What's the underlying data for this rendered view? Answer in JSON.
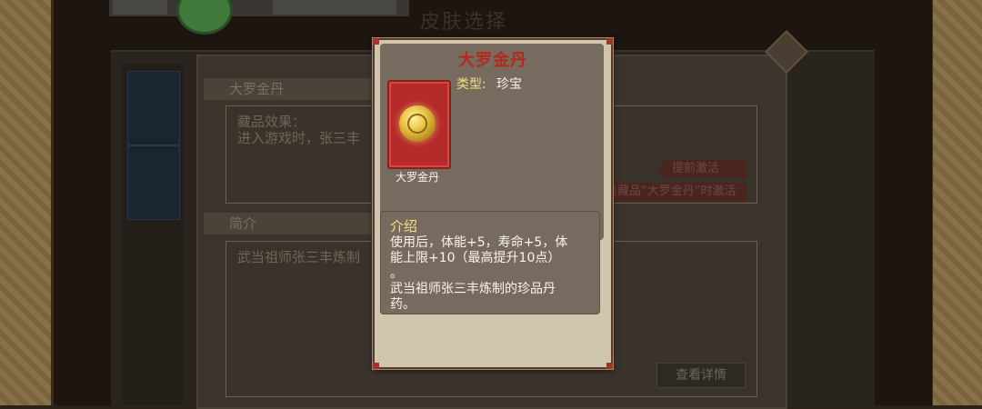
{
  "background": {
    "title": "皮肤选择",
    "section_header_1": "大罗金丹",
    "effect_label": "藏品效果：",
    "effect_text": "进入游戏时，张三丰",
    "section_header_2": "简介",
    "intro_text": "武当祖师张三丰炼制",
    "activate_button": "提前激活",
    "condition_text": "当藏品“大罗金丹”时激活",
    "detail_button": "查看详情"
  },
  "popup": {
    "title": "大罗金丹",
    "type_label": "类型:",
    "type_value": "珍宝",
    "item_name": "大罗金丹",
    "intro_heading": "介绍",
    "intro_body": "使用后，体能+5，寿命+5，体\n能上限+10（最高提升10点）\n。\n武当祖师张三丰炼制的珍品丹\n药。"
  },
  "colors": {
    "title_red": "#b32a1d",
    "label_yellow": "#f1e27c",
    "text_white": "#fbf6e8",
    "card_bg": "#cfc6ad",
    "inner_panel": "#776b5f",
    "item_frame_red": "#b52b2b"
  },
  "icons": [
    "gold-pill-icon",
    "close-diamond-icon"
  ]
}
